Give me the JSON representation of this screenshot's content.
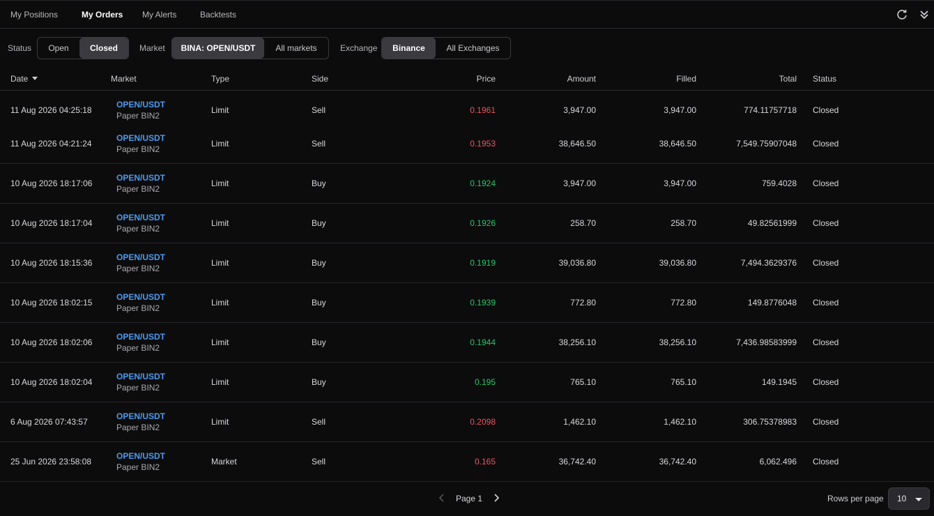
{
  "tabs": [
    {
      "label": "My Positions",
      "active": false
    },
    {
      "label": "My Orders",
      "active": true
    },
    {
      "label": "My Alerts",
      "active": false
    },
    {
      "label": "Backtests",
      "active": false
    }
  ],
  "toolbar": {
    "refresh_icon": "refresh-icon",
    "collapse_icon": "double-chevron-down-icon"
  },
  "filters": {
    "status_label": "Status",
    "status_options": [
      "Open",
      "Closed"
    ],
    "status_selected": "Closed",
    "market_label": "Market",
    "market_options": [
      "BINA: OPEN/USDT",
      "All markets"
    ],
    "market_selected": "BINA: OPEN/USDT",
    "exchange_label": "Exchange",
    "exchange_options": [
      "Binance",
      "All Exchanges"
    ],
    "exchange_selected": "Binance"
  },
  "table": {
    "columns": [
      "Date",
      "Market",
      "Type",
      "Side",
      "Price",
      "Amount",
      "Filled",
      "Total",
      "Status"
    ],
    "sort_column": "Date",
    "sort_direction": "desc",
    "rows": [
      {
        "date": "11 Aug 2026 04:25:18",
        "pair": "OPEN/USDT",
        "account": "Paper BIN2",
        "type": "Limit",
        "side": "Sell",
        "price": "0.1961",
        "amount": "3,947.00",
        "filled": "3,947.00",
        "total": "774.11757718",
        "status": "Closed"
      },
      {
        "date": "11 Aug 2026 04:21:24",
        "pair": "OPEN/USDT",
        "account": "Paper BIN2",
        "type": "Limit",
        "side": "Sell",
        "price": "0.1953",
        "amount": "38,646.50",
        "filled": "38,646.50",
        "total": "7,549.75907048",
        "status": "Closed"
      },
      {
        "date": "10 Aug 2026 18:17:06",
        "pair": "OPEN/USDT",
        "account": "Paper BIN2",
        "type": "Limit",
        "side": "Buy",
        "price": "0.1924",
        "amount": "3,947.00",
        "filled": "3,947.00",
        "total": "759.4028",
        "status": "Closed"
      },
      {
        "date": "10 Aug 2026 18:17:04",
        "pair": "OPEN/USDT",
        "account": "Paper BIN2",
        "type": "Limit",
        "side": "Buy",
        "price": "0.1926",
        "amount": "258.70",
        "filled": "258.70",
        "total": "49.82561999",
        "status": "Closed"
      },
      {
        "date": "10 Aug 2026 18:15:36",
        "pair": "OPEN/USDT",
        "account": "Paper BIN2",
        "type": "Limit",
        "side": "Buy",
        "price": "0.1919",
        "amount": "39,036.80",
        "filled": "39,036.80",
        "total": "7,494.3629376",
        "status": "Closed"
      },
      {
        "date": "10 Aug 2026 18:02:15",
        "pair": "OPEN/USDT",
        "account": "Paper BIN2",
        "type": "Limit",
        "side": "Buy",
        "price": "0.1939",
        "amount": "772.80",
        "filled": "772.80",
        "total": "149.8776048",
        "status": "Closed"
      },
      {
        "date": "10 Aug 2026 18:02:06",
        "pair": "OPEN/USDT",
        "account": "Paper BIN2",
        "type": "Limit",
        "side": "Buy",
        "price": "0.1944",
        "amount": "38,256.10",
        "filled": "38,256.10",
        "total": "7,436.98583999",
        "status": "Closed"
      },
      {
        "date": "10 Aug 2026 18:02:04",
        "pair": "OPEN/USDT",
        "account": "Paper BIN2",
        "type": "Limit",
        "side": "Buy",
        "price": "0.195",
        "amount": "765.10",
        "filled": "765.10",
        "total": "149.1945",
        "status": "Closed"
      },
      {
        "date": "6 Aug 2026 07:43:57",
        "pair": "OPEN/USDT",
        "account": "Paper BIN2",
        "type": "Limit",
        "side": "Sell",
        "price": "0.2098",
        "amount": "1,462.10",
        "filled": "1,462.10",
        "total": "306.75378983",
        "status": "Closed"
      },
      {
        "date": "25 Jun 2026 23:58:08",
        "pair": "OPEN/USDT",
        "account": "Paper BIN2",
        "type": "Market",
        "side": "Sell",
        "price": "0.165",
        "amount": "36,742.40",
        "filled": "36,742.40",
        "total": "6,062.496",
        "status": "Closed"
      }
    ]
  },
  "colors": {
    "buy": "#22c96a",
    "sell": "#ee5560",
    "link": "#4a9bf0"
  },
  "pagination": {
    "page_label": "Page 1",
    "rows_per_page_label": "Rows per page",
    "rows_per_page": "10"
  }
}
